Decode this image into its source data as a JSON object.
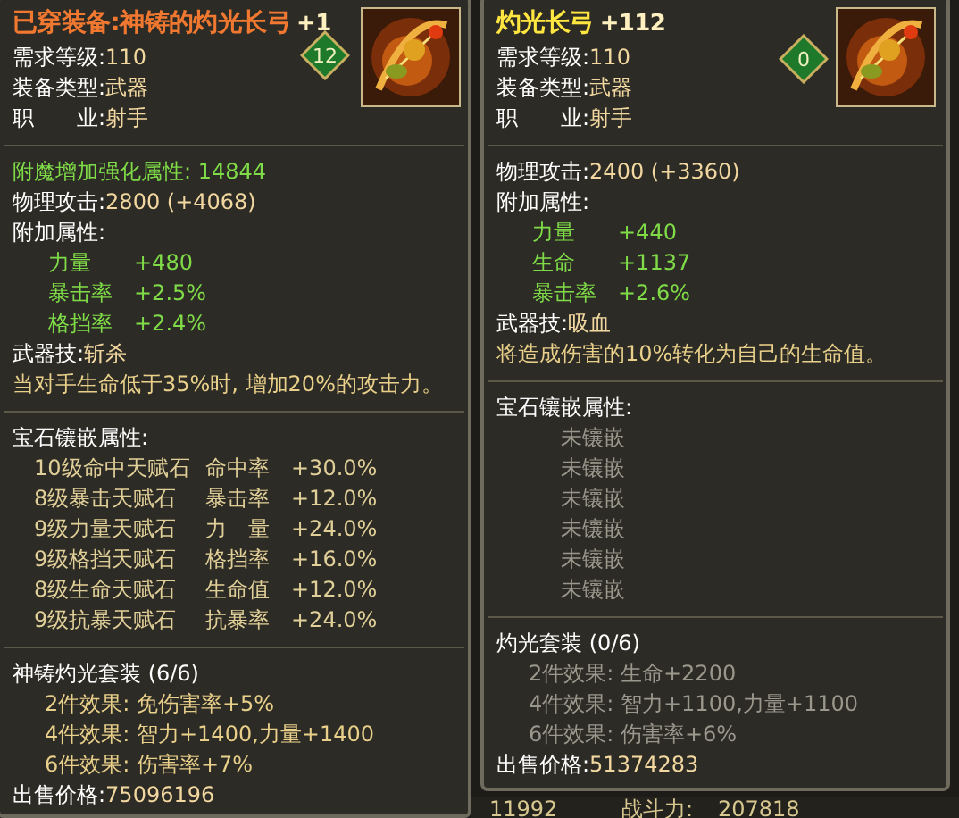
{
  "panels": [
    {
      "title": "已穿装备:神铸的灼光长弓",
      "kind": "equipped",
      "enhance": "+1",
      "socket_badge": "12",
      "info": [
        {
          "label": "需求等级:",
          "value": "110"
        },
        {
          "label": "装备类型:",
          "value": "武器"
        },
        {
          "label": "职　　业:",
          "value": "射手"
        }
      ],
      "sections": [
        [
          {
            "kind": "enchant",
            "text": "附魔增加强化属性: 14844"
          },
          {
            "kind": "stat",
            "label": "物理攻击:",
            "value": "2800 (+4068)"
          },
          {
            "kind": "heading",
            "text": "附加属性:"
          },
          {
            "kind": "attr",
            "label": "力量",
            "value": "+480"
          },
          {
            "kind": "attr",
            "label": "暴击率",
            "value": "+2.5%"
          },
          {
            "kind": "attr",
            "label": "格挡率",
            "value": "+2.4%"
          },
          {
            "kind": "stat",
            "label": "武器技:",
            "value": "斩杀"
          },
          {
            "kind": "desc",
            "text": "当对手生命低于35%时, 增加20%的攻击力。"
          }
        ],
        [
          {
            "kind": "heading",
            "text": "宝石镶嵌属性:"
          },
          {
            "kind": "gem",
            "name": "10级命中天赋石",
            "stat": "命中率",
            "value": "+30.0%"
          },
          {
            "kind": "gem",
            "name": "8级暴击天赋石",
            "stat": "暴击率",
            "value": "+12.0%"
          },
          {
            "kind": "gem",
            "name": "9级力量天赋石",
            "stat": "力　量",
            "value": "+24.0%"
          },
          {
            "kind": "gem",
            "name": "9级格挡天赋石",
            "stat": "格挡率",
            "value": "+16.0%"
          },
          {
            "kind": "gem",
            "name": "8级生命天赋石",
            "stat": "生命值",
            "value": "+12.0%"
          },
          {
            "kind": "gem",
            "name": "9级抗暴天赋石",
            "stat": "抗暴率",
            "value": "+24.0%"
          }
        ],
        [
          {
            "kind": "heading",
            "text": "神铸灼光套装 (6/6)"
          },
          {
            "kind": "set_effect",
            "active": true,
            "text": "2件效果: 免伤害率+5%"
          },
          {
            "kind": "set_effect",
            "active": true,
            "text": "4件效果: 智力+1400,力量+1400"
          },
          {
            "kind": "set_effect",
            "active": true,
            "text": "6件效果: 伤害率+7%"
          },
          {
            "kind": "stat",
            "label": "出售价格:",
            "value": "75096196"
          }
        ]
      ]
    },
    {
      "title": "灼光长弓",
      "kind": "compare",
      "enhance": "+112",
      "socket_badge": "0",
      "info": [
        {
          "label": "需求等级:",
          "value": "110"
        },
        {
          "label": "装备类型:",
          "value": "武器"
        },
        {
          "label": "职　　业:",
          "value": "射手"
        }
      ],
      "sections": [
        [
          {
            "kind": "stat",
            "label": "物理攻击:",
            "value": "2400 (+3360)"
          },
          {
            "kind": "heading",
            "text": "附加属性:"
          },
          {
            "kind": "attr",
            "label": "力量",
            "value": "+440"
          },
          {
            "kind": "attr",
            "label": "生命",
            "value": "+1137"
          },
          {
            "kind": "attr",
            "label": "暴击率",
            "value": "+2.6%"
          },
          {
            "kind": "stat",
            "label": "武器技:",
            "value": "吸血"
          },
          {
            "kind": "desc",
            "text": "将造成伤害的10%转化为自己的生命值。"
          }
        ],
        [
          {
            "kind": "heading",
            "text": "宝石镶嵌属性:"
          },
          {
            "kind": "empty_socket",
            "text": "未镶嵌"
          },
          {
            "kind": "empty_socket",
            "text": "未镶嵌"
          },
          {
            "kind": "empty_socket",
            "text": "未镶嵌"
          },
          {
            "kind": "empty_socket",
            "text": "未镶嵌"
          },
          {
            "kind": "empty_socket",
            "text": "未镶嵌"
          },
          {
            "kind": "empty_socket",
            "text": "未镶嵌"
          }
        ],
        [
          {
            "kind": "heading",
            "text": "灼光套装 (0/6)"
          },
          {
            "kind": "set_effect",
            "active": false,
            "text": "2件效果: 生命+2200"
          },
          {
            "kind": "set_effect",
            "active": false,
            "text": "4件效果: 智力+1100,力量+1100"
          },
          {
            "kind": "set_effect",
            "active": false,
            "text": "6件效果: 伤害率+6%"
          },
          {
            "kind": "stat",
            "label": "出售价格:",
            "value": "51374283"
          }
        ]
      ]
    }
  ],
  "footer": {
    "level": "11992",
    "power_label": "战斗力:",
    "power": "207818"
  }
}
